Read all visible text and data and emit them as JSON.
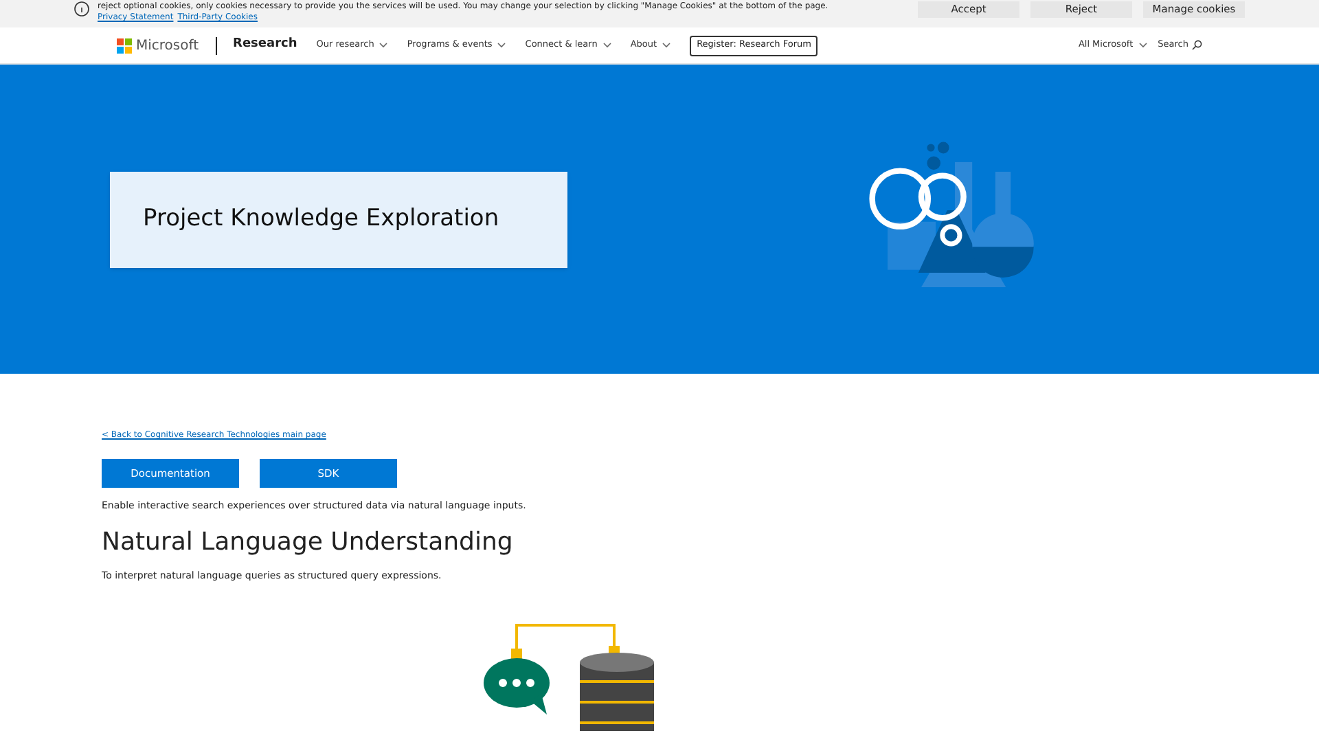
{
  "cookie_banner": {
    "text": "reject optional cookies, only cookies necessary to provide you the services will be used. You may change your selection by clicking \"Manage Cookies\" at the bottom of the page.",
    "links": [
      "Privacy Statement",
      "Third-Party Cookies"
    ],
    "buttons": [
      "Accept",
      "Reject",
      "Manage cookies"
    ]
  },
  "nav": {
    "brand": "Microsoft",
    "section": "Research",
    "menus": [
      {
        "label": "Our research"
      },
      {
        "label": "Programs & events"
      },
      {
        "label": "Connect & learn"
      },
      {
        "label": "About"
      }
    ],
    "cta": "Register: Research Forum",
    "all_menu": "All Microsoft",
    "search": "Search"
  },
  "hero": {
    "title": "Project Knowledge Exploration"
  },
  "content": {
    "back_link": "< Back to Cognitive Research Technologies main page",
    "buttons": [
      "Documentation",
      "SDK"
    ],
    "intro": "Enable interactive search experiences over structured data via natural language inputs.",
    "heading": "Natural Language Understanding",
    "description": "To interpret natural language queries as structured query expressions."
  }
}
